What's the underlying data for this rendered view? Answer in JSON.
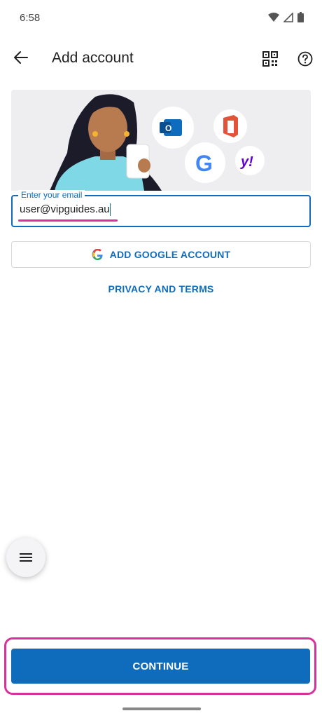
{
  "status": {
    "time": "6:58"
  },
  "appbar": {
    "title": "Add account",
    "back_icon": "arrow-left-icon",
    "qr_icon": "qr-code-icon",
    "help_icon": "help-circle-icon"
  },
  "email": {
    "legend": "Enter your email",
    "value": "user@vipguides.au"
  },
  "google_button": {
    "label": "ADD GOOGLE ACCOUNT"
  },
  "privacy": {
    "label": "PRIVACY AND TERMS"
  },
  "fab": {
    "icon": "menu-icon"
  },
  "continue": {
    "label": "CONTINUE"
  },
  "colors": {
    "accent": "#0f6cbd",
    "highlight": "#d6339a",
    "hero_bg": "#eeeef0"
  }
}
